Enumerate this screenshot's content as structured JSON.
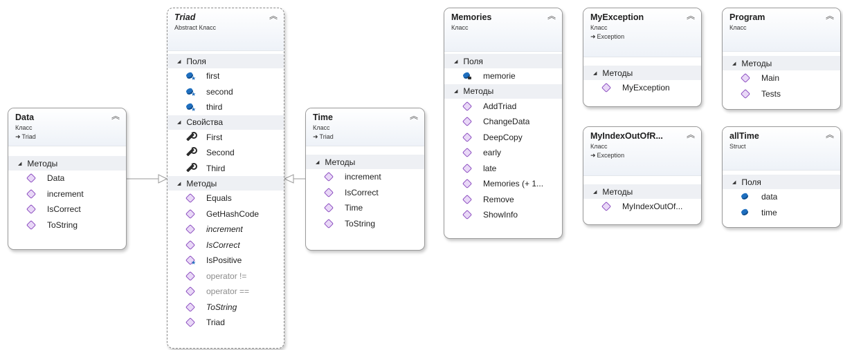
{
  "colors": {
    "border": "#9a9a9a",
    "section_bg": "#eef0f4",
    "method_icon": "#8a4bbf",
    "field_icon": "#1f6fbf",
    "grey_text": "#8c8c8c"
  },
  "icons": {
    "collapse": "double-chevron-up-icon",
    "section": "triangle-icon",
    "method": "method-cube-icon",
    "field": "field-icon",
    "property": "wrench-icon",
    "inherit": "inheritance-arrow-icon"
  },
  "classes": {
    "data": {
      "name": "Data",
      "kind": "Класс",
      "base": "Triad",
      "sections": [
        {
          "title": "Методы",
          "items": [
            "Data",
            "increment",
            "IsCorrect",
            "ToString"
          ]
        }
      ]
    },
    "triad": {
      "name": "Triad",
      "kind": "Abstract Класс",
      "fields_title": "Поля",
      "fields": [
        "first",
        "second",
        "third"
      ],
      "props_title": "Свойства",
      "props": [
        "First",
        "Second",
        "Third"
      ],
      "methods_title": "Методы",
      "methods": [
        "Equals",
        "GetHashCode",
        "increment",
        "IsCorrect",
        "IsPositive",
        "operator !=",
        "operator ==",
        "ToString",
        "Triad"
      ]
    },
    "time": {
      "name": "Time",
      "kind": "Класс",
      "base": "Triad",
      "methods_title": "Методы",
      "methods": [
        "increment",
        "IsCorrect",
        "Time",
        "ToString"
      ]
    },
    "memories": {
      "name": "Memories",
      "kind": "Класс",
      "fields_title": "Поля",
      "fields": [
        "memorie"
      ],
      "methods_title": "Методы",
      "methods": [
        "AddTriad",
        "ChangeData",
        "DeepCopy",
        "early",
        "late",
        "Memories (+ 1...",
        "Remove",
        "ShowInfo"
      ]
    },
    "myexception": {
      "name": "MyException",
      "kind": "Класс",
      "base": "Exception",
      "methods_title": "Методы",
      "methods": [
        "MyException"
      ]
    },
    "myindex": {
      "name": "MyIndexOutOfR...",
      "kind": "Класс",
      "base": "Exception",
      "methods_title": "Методы",
      "methods": [
        "MyIndexOutOf..."
      ]
    },
    "program": {
      "name": "Program",
      "kind": "Класс",
      "methods_title": "Методы",
      "methods": [
        "Main",
        "Tests"
      ]
    },
    "alltime": {
      "name": "allTime",
      "kind": "Struct",
      "fields_title": "Поля",
      "fields": [
        "data",
        "time"
      ]
    }
  }
}
